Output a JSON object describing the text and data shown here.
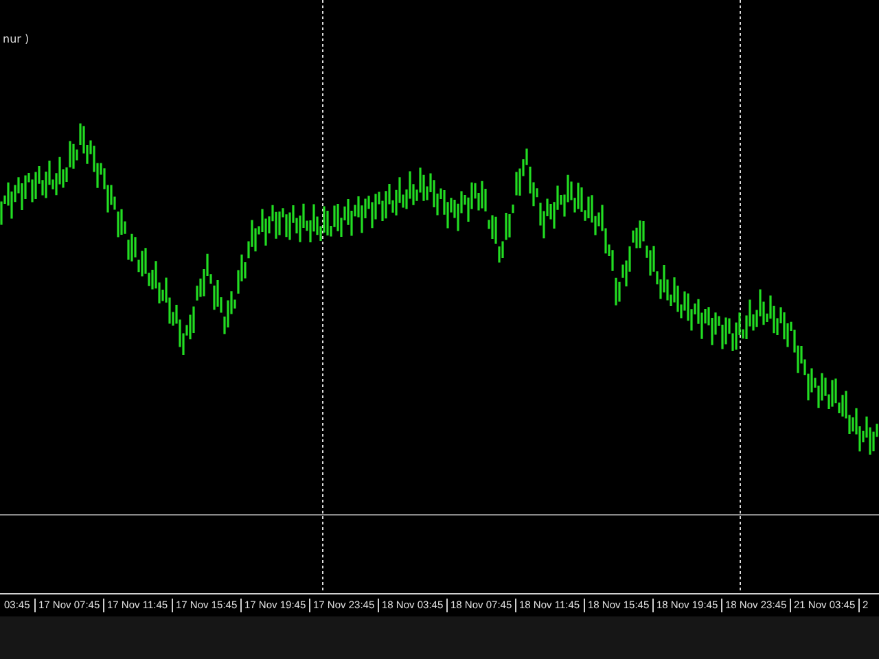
{
  "chart_label": "nur )",
  "time_axis": [
    "03:45",
    "17 Nov 07:45",
    "17 Nov 11:45",
    "17 Nov 15:45",
    "17 Nov 19:45",
    "17 Nov 23:45",
    "18 Nov 03:45",
    "18 Nov 07:45",
    "18 Nov 11:45",
    "18 Nov 15:45",
    "18 Nov 19:45",
    "18 Nov 23:45",
    "21 Nov 03:45",
    "2"
  ]
}
